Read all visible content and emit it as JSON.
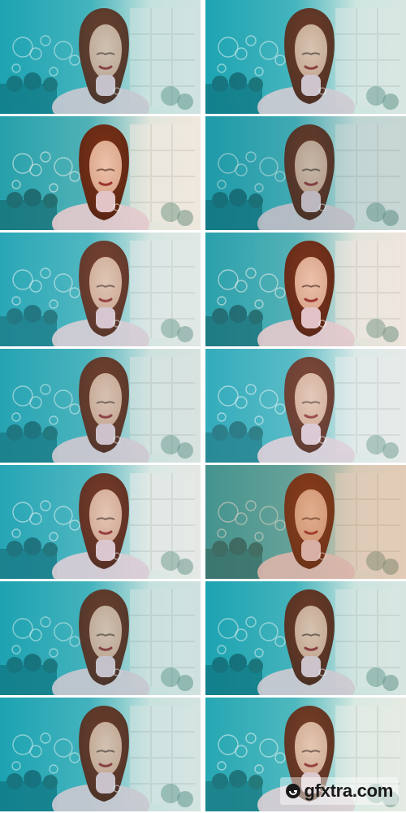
{
  "image": {
    "description_grid": {
      "rows": 7,
      "cols": 2
    }
  },
  "tints": [
    {
      "overlay": "#2fa9b3",
      "opacity": 0.18
    },
    {
      "overlay": "#2fa9b3",
      "opacity": 0.14
    },
    {
      "overlay": "#b47d4a",
      "opacity": 0.08
    },
    {
      "overlay": "#2b7d86",
      "opacity": 0.22
    },
    {
      "overlay": "#7fb8c7",
      "opacity": 0.16
    },
    {
      "overlay": "#b98e6e",
      "opacity": 0.1
    },
    {
      "overlay": "#5ba6b3",
      "opacity": 0.18
    },
    {
      "overlay": "#a6d0e4",
      "opacity": 0.18
    },
    {
      "overlay": "#7fb8c7",
      "opacity": 0.12
    },
    {
      "overlay": "#b56b33",
      "opacity": 0.28
    },
    {
      "overlay": "#2aa2ad",
      "opacity": 0.18
    },
    {
      "overlay": "#2aa2ad",
      "opacity": 0.14
    },
    {
      "overlay": "#2aa2ad",
      "opacity": 0.16
    },
    {
      "overlay": "#7fc5b8",
      "opacity": 0.12
    }
  ],
  "watermark": {
    "text": "gfxtra.com"
  }
}
